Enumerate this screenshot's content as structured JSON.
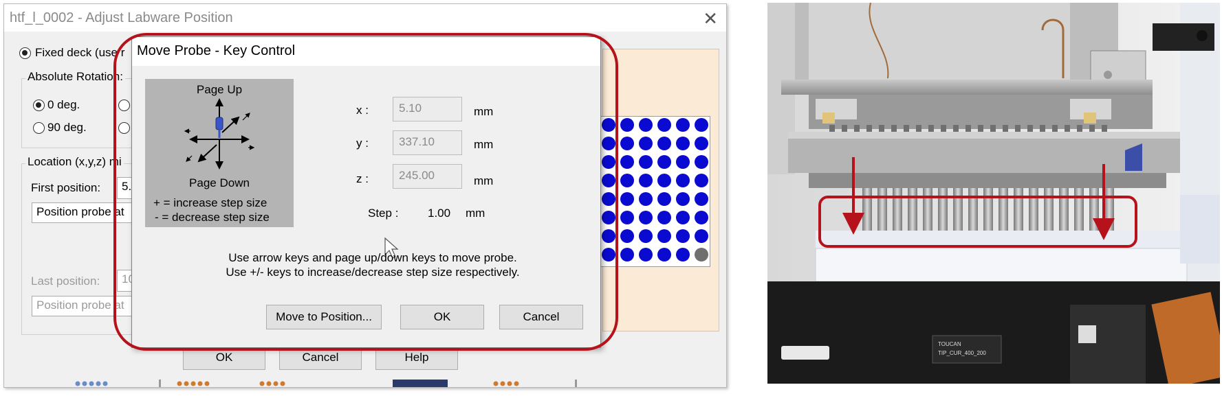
{
  "parent_window": {
    "title": "htf_l_0002 - Adjust Labware Position",
    "close_glyph": "✕",
    "fixed_deck_label": "Fixed deck (use r",
    "rotation_group": {
      "legend": "Absolute Rotation:",
      "options": [
        {
          "label": "0 deg.",
          "checked": true
        },
        {
          "label": "90 deg.",
          "checked": false
        }
      ]
    },
    "location_group": {
      "legend": "Location (x,y,z) mi",
      "first_position_label": "First position:",
      "first_position_value": "5.",
      "position_probe_first": "Position probe at",
      "last_position_label": "Last position:",
      "last_position_value": "10",
      "position_probe_last": "Position probe at"
    },
    "buttons": {
      "ok": "OK",
      "cancel": "Cancel",
      "help": "Help"
    },
    "deck_colors": {
      "well": "#0a0ad0",
      "well_empty": "#6f6f6f",
      "panel": "#fbebd6"
    }
  },
  "dialog": {
    "title": "Move Probe - Key Control",
    "key_panel": {
      "page_up": "Page Up",
      "page_down": "Page Down",
      "increase_hint": "+ = increase step size",
      "decrease_hint": "- = decrease step size"
    },
    "fields": {
      "x_label": "x :",
      "x_value": "5.10",
      "x_unit": "mm",
      "y_label": "y :",
      "y_value": "337.10",
      "y_unit": "mm",
      "z_label": "z :",
      "z_value": "245.00",
      "z_unit": "mm"
    },
    "step": {
      "label": "Step :",
      "value": "1.00",
      "unit": "mm"
    },
    "instructions": [
      "Use arrow keys and page up/down keys to move probe.",
      "Use +/- keys to increase/decrease step size respectively."
    ],
    "buttons": {
      "move_to_position": "Move to Position...",
      "ok": "OK",
      "cancel": "Cancel"
    }
  },
  "annotation": {
    "color": "#b5121b"
  },
  "photo": {
    "label_plate_line1": "TOUCAN",
    "label_plate_line2": "TIP_CUR_400_200"
  }
}
